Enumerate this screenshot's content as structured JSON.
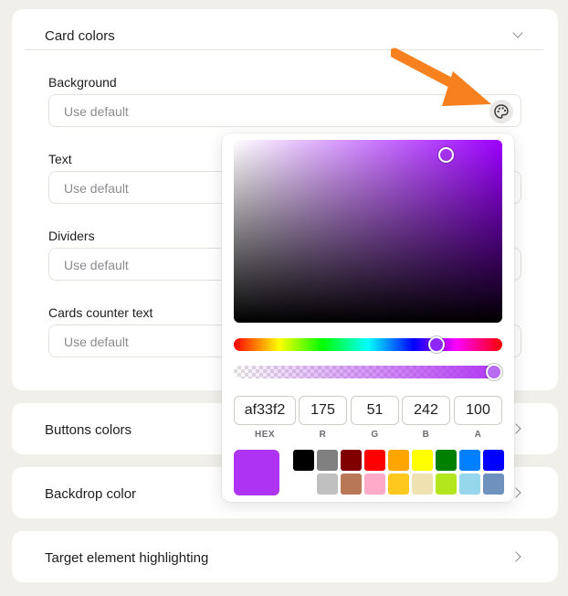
{
  "card_colors": {
    "title": "Card colors",
    "fields": [
      {
        "label": "Background",
        "placeholder": "Use default"
      },
      {
        "label": "Text",
        "placeholder": "Use default"
      },
      {
        "label": "Dividers",
        "placeholder": "Use default"
      },
      {
        "label": "Cards counter text",
        "placeholder": "Use default"
      }
    ]
  },
  "sections": [
    {
      "title": "Buttons colors"
    },
    {
      "title": "Backdrop color"
    },
    {
      "title": "Target element highlighting"
    }
  ],
  "picker": {
    "values": [
      {
        "label": "HEX",
        "value": "af33f2"
      },
      {
        "label": "R",
        "value": "175"
      },
      {
        "label": "G",
        "value": "51"
      },
      {
        "label": "B",
        "value": "242"
      },
      {
        "label": "A",
        "value": "100"
      }
    ],
    "current_color": "#af33f2",
    "swatches_row1": [
      "#000000",
      "#808080",
      "#800000",
      "#ff0000",
      "#ffa500",
      "#ffff00",
      "#008000",
      "#0080ff",
      "#0000ff"
    ],
    "swatches_row2": [
      "#c0c0c0",
      "#b87855",
      "#ffaac8",
      "#ffc81e",
      "#efe2b0",
      "#b4e61e",
      "#96d7eb",
      "#6e91be"
    ]
  },
  "colors": {
    "accent_arrow": "#f7801f"
  }
}
